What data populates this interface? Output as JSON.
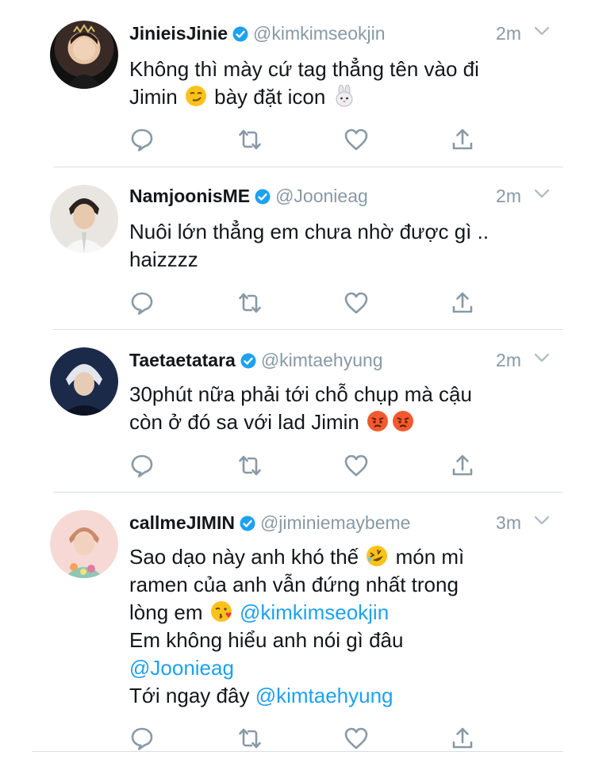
{
  "colors": {
    "name": "#14171a",
    "handle": "#8899a6",
    "mention": "#1da1f2",
    "icon": "#8899a6",
    "verified": "#1da1f2"
  },
  "tweets": [
    {
      "name": "JinieisJinie",
      "handle": "@kimkimseokjin",
      "time": "2m",
      "line1": "Không thì mày cứ tag thẳng tên vào đi",
      "line2_a": "Jimin",
      "emoji1": "smirking-face",
      "line2_b": "bày đặt icon",
      "emoji2": "rabbit-face"
    },
    {
      "name": "NamjoonisME",
      "handle": "@Joonieag",
      "time": "2m",
      "line1": "Nuôi lớn thẳng em chưa nhờ được gì ..",
      "line2": "haizzzz"
    },
    {
      "name": "Taetaetatara",
      "handle": "@kimtaehyung",
      "time": "2m",
      "line1": "30phút nữa phải tới chỗ chụp mà cậu",
      "line2": "còn ở đó sa với lad Jimin",
      "emoji1": "pouting-face",
      "emoji2": "pouting-face"
    },
    {
      "name": "callmeJIMIN",
      "handle": "@jiminiemaybeme",
      "time": "3m",
      "line1_a": "Sao dạo này anh khó thế",
      "emoji1": "rolling-on-floor-laughing",
      "line1_b": "món mì",
      "line2": "ramen của anh vẫn đứng nhất trong",
      "line3_a": "lòng em",
      "emoji2": "face-blowing-kiss",
      "line3_mention": "@kimkimseokjin",
      "line4": "Em không hiểu anh nói gì đâu",
      "line5_mention": "@Joonieag",
      "line6_a": "Tới ngay đây",
      "line6_mention": "@kimtaehyung"
    }
  ],
  "icons": [
    "reply-icon",
    "retweet-icon",
    "like-icon",
    "share-icon"
  ]
}
